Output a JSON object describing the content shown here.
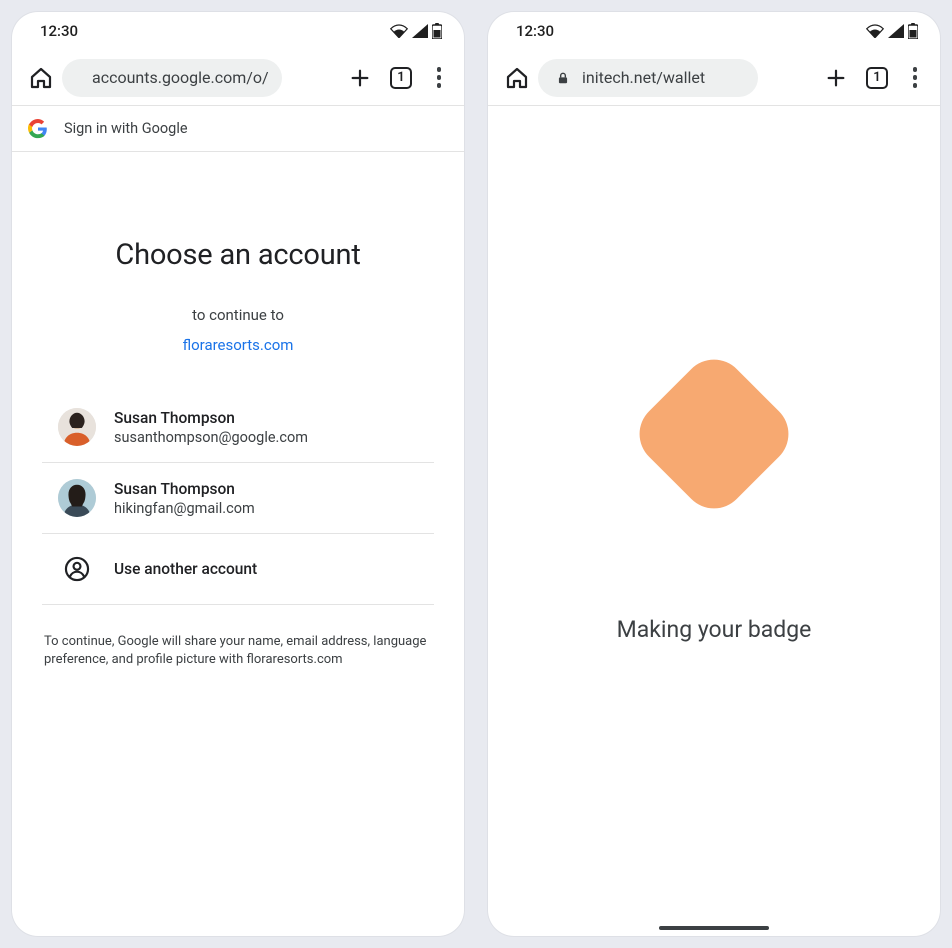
{
  "status": {
    "time": "12:30",
    "tab_count": "1"
  },
  "left": {
    "url": "accounts.google.com/o/",
    "signin_bar": "Sign in with Google",
    "title": "Choose an account",
    "continue_to": "to continue to",
    "continue_link": "floraresorts.com",
    "accounts": [
      {
        "name": "Susan Thompson",
        "email": "susanthompson@google.com"
      },
      {
        "name": "Susan Thompson",
        "email": "hikingfan@gmail.com"
      }
    ],
    "use_another": "Use another account",
    "disclosure": "To continue, Google will share your name, email address, language preference, and profile picture with floraresorts.com"
  },
  "right": {
    "url": "initech.net/wallet",
    "badge_label": "Making your badge"
  }
}
